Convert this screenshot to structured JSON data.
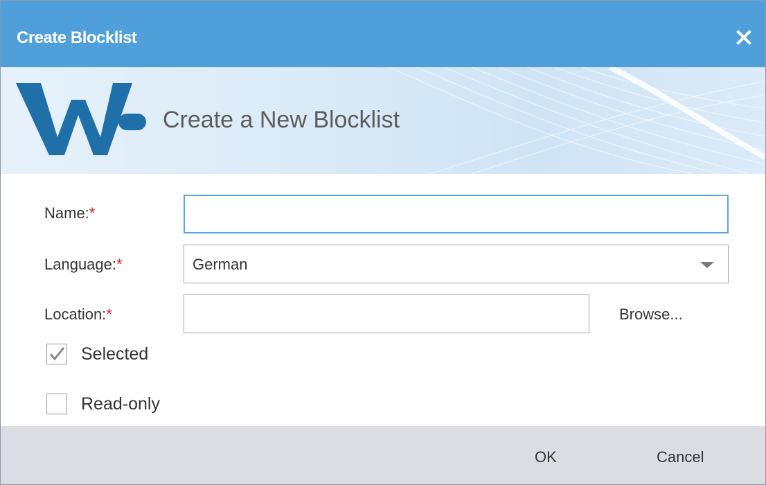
{
  "dialog": {
    "title": "Create Blocklist",
    "close_icon": "close-icon",
    "header_bg": "#4f9fdb"
  },
  "banner": {
    "logo": "wf-logo",
    "heading": "Create a New Blocklist",
    "logo_color": "#1f6fa8"
  },
  "form": {
    "name": {
      "label": "Name:",
      "required_mark": "*",
      "value": ""
    },
    "language": {
      "label": "Language:",
      "required_mark": "*",
      "selected": "German",
      "dropdown_icon": "chevron-down-icon"
    },
    "location": {
      "label": "Location:",
      "required_mark": "*",
      "value": "",
      "browse_label": "Browse..."
    },
    "selected": {
      "label": "Selected",
      "checked": true
    },
    "read_only": {
      "label": "Read-only",
      "checked": false
    }
  },
  "footer": {
    "ok_label": "OK",
    "cancel_label": "Cancel",
    "bg": "#dcdde2"
  }
}
